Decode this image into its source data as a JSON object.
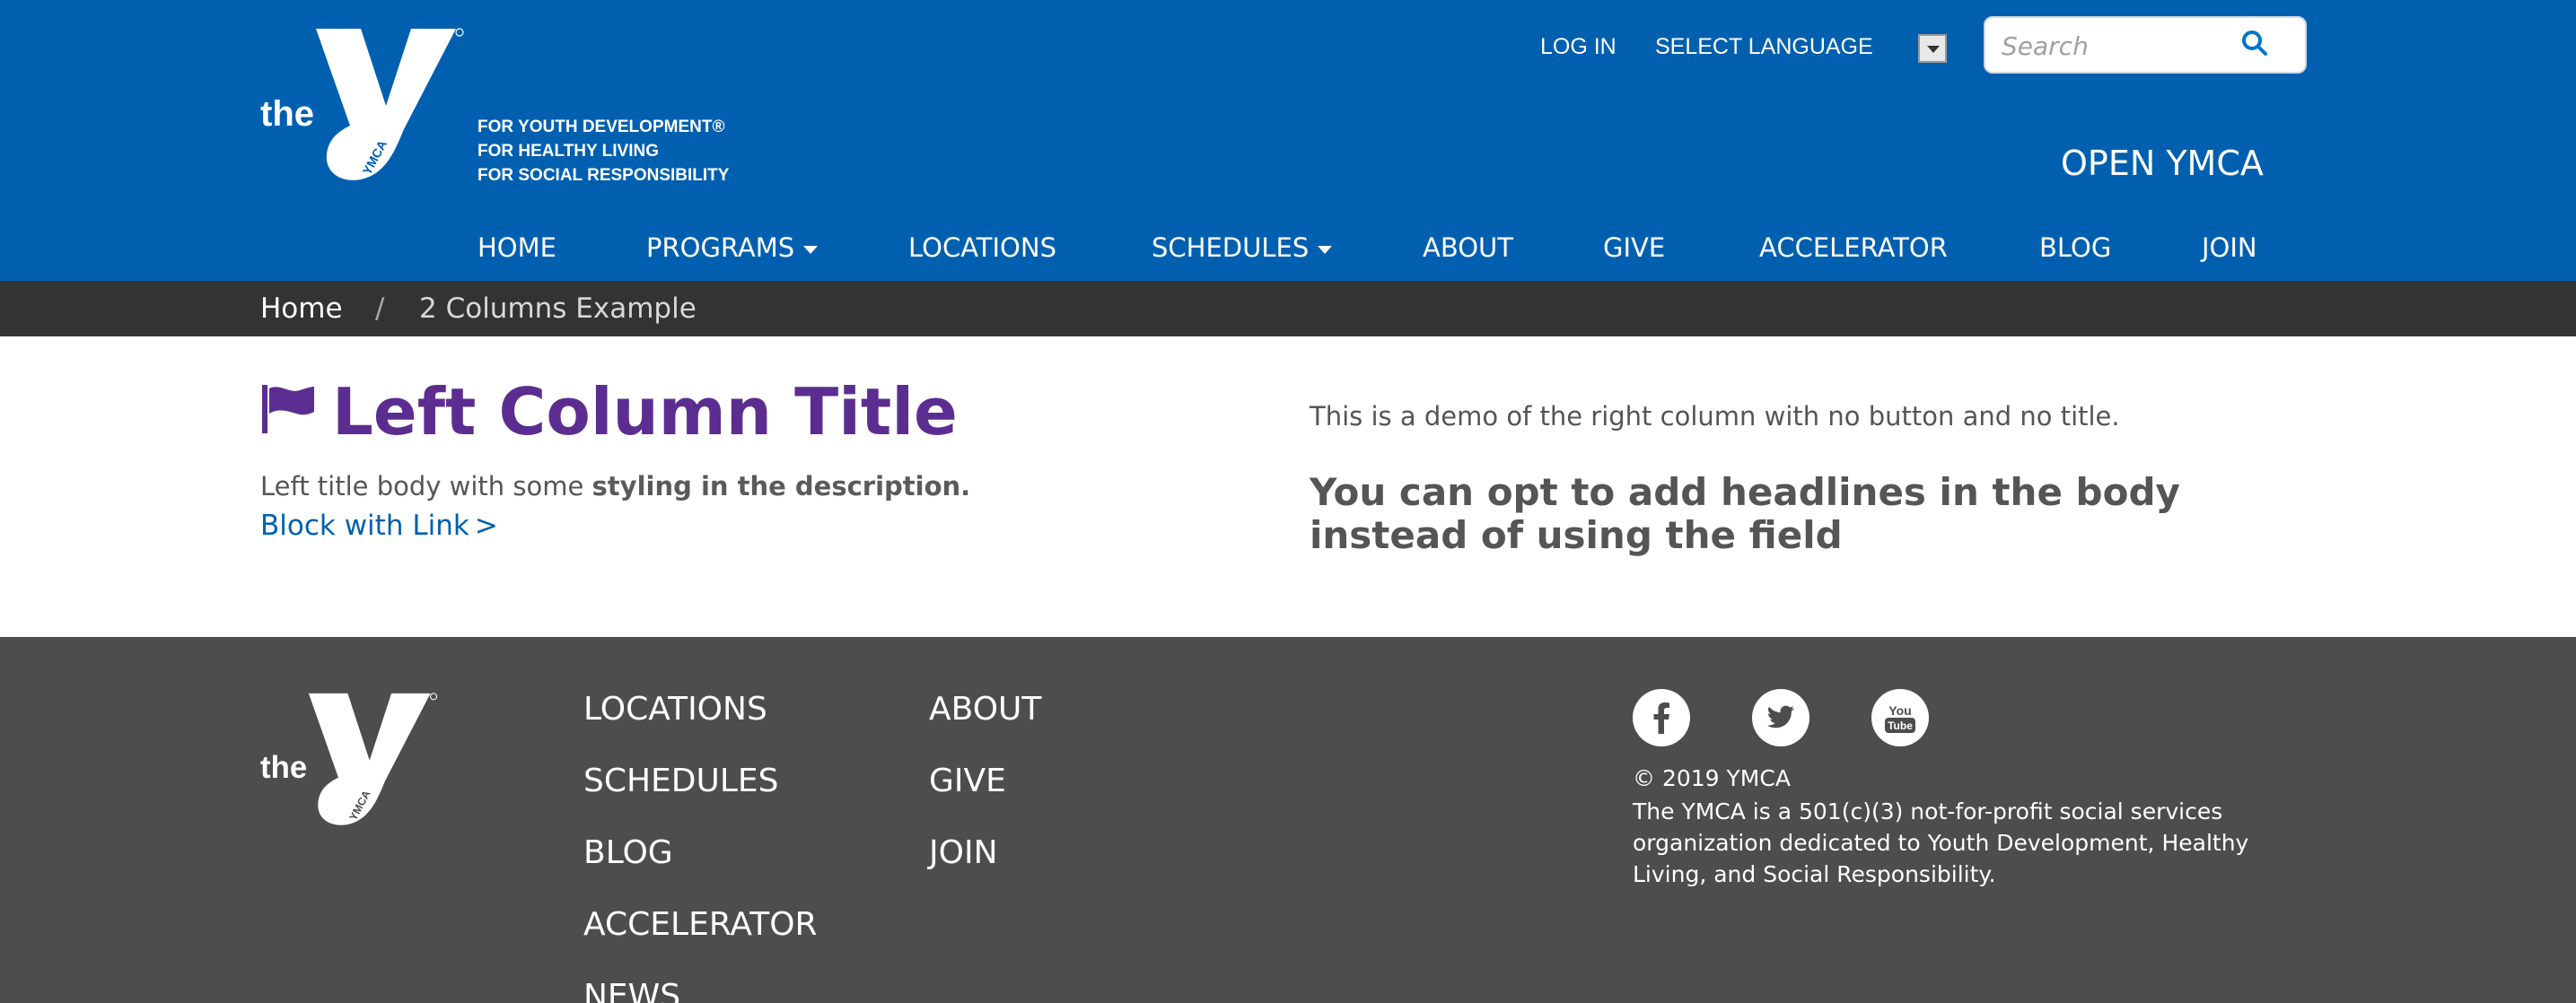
{
  "header": {
    "logo_word": "the",
    "logo_sub": "YMCA",
    "tagline": [
      "FOR YOUTH DEVELOPMENT®",
      "FOR HEALTHY LIVING",
      "FOR SOCIAL RESPONSIBILITY"
    ],
    "login": "LOG IN",
    "select_language": "SELECT LANGUAGE",
    "search_placeholder": "Search",
    "open_ymca": "OPEN YMCA",
    "nav": [
      {
        "label": "HOME",
        "dropdown": false
      },
      {
        "label": "PROGRAMS",
        "dropdown": true
      },
      {
        "label": "LOCATIONS",
        "dropdown": false
      },
      {
        "label": "SCHEDULES",
        "dropdown": true
      },
      {
        "label": "ABOUT",
        "dropdown": false
      },
      {
        "label": "GIVE",
        "dropdown": false
      },
      {
        "label": "ACCELERATOR",
        "dropdown": false
      },
      {
        "label": "BLOG",
        "dropdown": false
      },
      {
        "label": "JOIN",
        "dropdown": false
      }
    ]
  },
  "breadcrumb": {
    "home": "Home",
    "separator": "/",
    "current": "2 Columns Example"
  },
  "main": {
    "left": {
      "icon": "flag-icon",
      "title": "Left Column Title",
      "body_plain": "Left title body with some ",
      "body_bold": "styling in the description.",
      "link_label": "Block with Link",
      "link_arrow": ">"
    },
    "right": {
      "body": "This is a demo of the right column with no button and no title.",
      "headline": "You can opt to add headlines in the body instead of using the field"
    }
  },
  "footer": {
    "logo_word": "the",
    "logo_sub": "YMCA",
    "links_col1": [
      "LOCATIONS",
      "SCHEDULES",
      "BLOG",
      "ACCELERATOR",
      "NEWS"
    ],
    "links_col2": [
      "ABOUT",
      "GIVE",
      "JOIN"
    ],
    "social": [
      "facebook-icon",
      "twitter-icon",
      "youtube-icon"
    ],
    "copyright": "© 2019 YMCA",
    "mission": "The YMCA is a 501(c)(3) not-for-profit social services organization dedicated to Youth Development, Healthy Living, and Social Responsibility."
  },
  "colors": {
    "header_blue": "#0060af",
    "breadcrumb_bg": "#333333",
    "title_purple": "#5c2d91",
    "link_blue": "#0060af",
    "footer_bg": "#4d4d4d"
  }
}
